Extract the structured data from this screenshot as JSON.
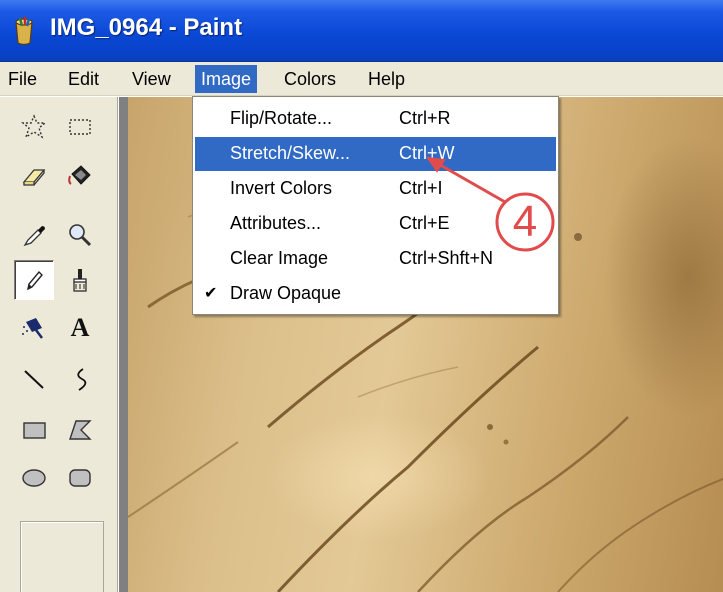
{
  "window": {
    "title": "IMG_0964 - Paint",
    "app_icon": "paint-bucket-icon"
  },
  "menubar": {
    "items": [
      {
        "label": "File"
      },
      {
        "label": "Edit"
      },
      {
        "label": "View"
      },
      {
        "label": "Image",
        "active": true
      },
      {
        "label": "Colors"
      },
      {
        "label": "Help"
      }
    ]
  },
  "image_menu": {
    "items": [
      {
        "label": "Flip/Rotate...",
        "shortcut": "Ctrl+R"
      },
      {
        "label": "Stretch/Skew...",
        "shortcut": "Ctrl+W",
        "highlighted": true
      },
      {
        "label": "Invert Colors",
        "shortcut": "Ctrl+I"
      },
      {
        "label": "Attributes...",
        "shortcut": "Ctrl+E"
      },
      {
        "label": "Clear Image",
        "shortcut": "Ctrl+Shft+N"
      },
      {
        "label": "Draw Opaque",
        "shortcut": "",
        "checked": true
      }
    ]
  },
  "toolbox": {
    "tools": [
      {
        "icon": "free-form-select-icon"
      },
      {
        "icon": "rectangle-select-icon"
      },
      {
        "icon": "eraser-icon"
      },
      {
        "icon": "fill-bucket-icon"
      },
      {
        "icon": "pick-color-icon"
      },
      {
        "icon": "magnifier-icon"
      },
      {
        "icon": "pencil-icon",
        "selected": true
      },
      {
        "icon": "brush-icon"
      },
      {
        "icon": "airbrush-icon"
      },
      {
        "icon": "text-icon",
        "glyph": "A"
      },
      {
        "icon": "line-icon"
      },
      {
        "icon": "curve-icon"
      },
      {
        "icon": "rectangle-icon"
      },
      {
        "icon": "polygon-icon"
      },
      {
        "icon": "ellipse-icon"
      },
      {
        "icon": "rounded-rectangle-icon"
      }
    ]
  },
  "annotation": {
    "step_number": "4",
    "color": "#e14b4b"
  },
  "colors": {
    "titlebar": "#0a48d6",
    "menu_highlight": "#316ac5",
    "chrome": "#ece9d8"
  }
}
